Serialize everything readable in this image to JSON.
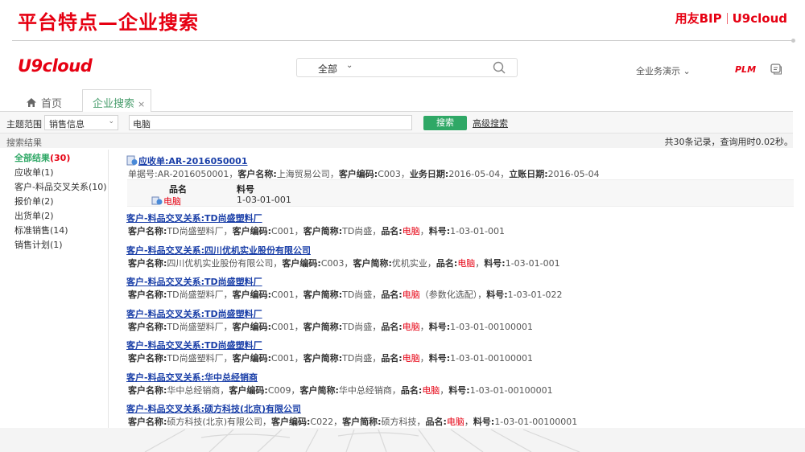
{
  "slide": {
    "title": "平台特点—企业搜索",
    "brand_left": "用友BIP",
    "brand_right": "U9cloud"
  },
  "app": {
    "logo": "U9cloud",
    "global_search": {
      "scope": "全部"
    },
    "demo_menu": "全业务演示",
    "plm": "PLM"
  },
  "tabs": [
    {
      "label": "首页",
      "icon": "home-icon"
    },
    {
      "label": "企业搜索",
      "active": true
    }
  ],
  "filter": {
    "scope_label": "主题范围",
    "scope_value": "销售信息",
    "query": "电脑",
    "search_button": "搜索",
    "advanced_link": "高级搜索"
  },
  "results_header": {
    "label": "搜索结果",
    "summary": "共30条记录，查询用时0.02秒。"
  },
  "sidebar": {
    "all_label": "全部结果",
    "all_count": "(30)",
    "items": [
      "应收单(1)",
      "客户-料品交叉关系(10)",
      "报价单(2)",
      "出货单(2)",
      "标准销售(14)",
      "销售计划(1)"
    ]
  },
  "first_result": {
    "title": "应收单:AR-2016050001",
    "detail": {
      "k1": "单据号:",
      "v1": "AR-2016050001",
      "k2": "客户名称:",
      "v2": "上海贸易公司",
      "k3": "客户编码:",
      "v3": "C003",
      "k4": "业务日期:",
      "v4": "2016-05-04",
      "k5": "立账日期:",
      "v5": "2016-05-04"
    },
    "table": {
      "h1": "品名",
      "h2": "料号",
      "c1": "电脑",
      "c2": "1-03-01-001"
    }
  },
  "results": [
    {
      "title": "客户-料品交叉关系:TD尚盛塑料厂",
      "name_label": "客户名称:",
      "name": "TD尚盛塑料厂",
      "code_label": "客户编码:",
      "code": "C001",
      "short_label": "客户简称:",
      "short": "TD尚盛",
      "pn_label": "品名:",
      "pn": "电脑",
      "pn_suffix": "",
      "sku_label": "料号:",
      "sku": "1-03-01-001"
    },
    {
      "title": "客户-料品交叉关系:四川优机实业股份有限公司",
      "name_label": "客户名称:",
      "name": "四川优机实业股份有限公司",
      "code_label": "客户编码:",
      "code": "C003",
      "short_label": "客户简称:",
      "short": "优机实业",
      "pn_label": "品名:",
      "pn": "电脑",
      "pn_suffix": "",
      "sku_label": "料号:",
      "sku": "1-03-01-001"
    },
    {
      "title": "客户-料品交叉关系:TD尚盛塑料厂",
      "name_label": "客户名称:",
      "name": "TD尚盛塑料厂",
      "code_label": "客户编码:",
      "code": "C001",
      "short_label": "客户简称:",
      "short": "TD尚盛",
      "pn_label": "品名:",
      "pn": "电脑",
      "pn_suffix": "（参数化选配）",
      "sku_label": "料号:",
      "sku": "1-03-01-022"
    },
    {
      "title": "客户-料品交叉关系:TD尚盛塑料厂",
      "name_label": "客户名称:",
      "name": "TD尚盛塑料厂",
      "code_label": "客户编码:",
      "code": "C001",
      "short_label": "客户简称:",
      "short": "TD尚盛",
      "pn_label": "品名:",
      "pn": "电脑",
      "pn_suffix": "",
      "sku_label": "料号:",
      "sku": "1-03-01-00100001"
    },
    {
      "title": "客户-料品交叉关系:TD尚盛塑料厂",
      "name_label": "客户名称:",
      "name": "TD尚盛塑料厂",
      "code_label": "客户编码:",
      "code": "C001",
      "short_label": "客户简称:",
      "short": "TD尚盛",
      "pn_label": "品名:",
      "pn": "电脑",
      "pn_suffix": "",
      "sku_label": "料号:",
      "sku": "1-03-01-00100001"
    },
    {
      "title": "客户-料品交叉关系:华中总经销商",
      "name_label": "客户名称:",
      "name": "华中总经销商",
      "code_label": "客户编码:",
      "code": "C009",
      "short_label": "客户简称:",
      "short": "华中总经销商",
      "pn_label": "品名:",
      "pn": "电脑",
      "pn_suffix": "",
      "sku_label": "料号:",
      "sku": "1-03-01-00100001"
    },
    {
      "title": "客户-料品交叉关系:硕方科技(北京)有限公司",
      "name_label": "客户名称:",
      "name": "硕方科技(北京)有限公司",
      "code_label": "客户编码:",
      "code": "C022",
      "short_label": "客户简称:",
      "short": "硕方科技",
      "pn_label": "品名:",
      "pn": "电脑",
      "pn_suffix": "",
      "sku_label": "料号:",
      "sku": "1-03-01-00100001"
    }
  ],
  "colors": {
    "brand_red": "#e60012",
    "accent_green": "#2fa866",
    "link_blue": "#1a3fa8"
  }
}
